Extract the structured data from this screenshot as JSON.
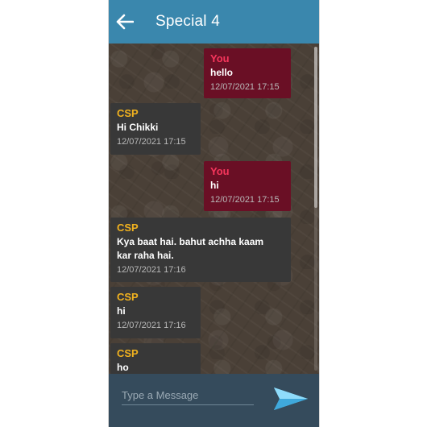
{
  "header": {
    "title": "Special 4",
    "back_icon": "arrow-left-icon"
  },
  "messages": [
    {
      "sender": "You",
      "text": "hello",
      "time": "12/07/2021 17:15"
    },
    {
      "sender": "CSP",
      "text": "Hi Chikki",
      "time": "12/07/2021 17:15"
    },
    {
      "sender": "You",
      "text": "hi",
      "time": "12/07/2021 17:15"
    },
    {
      "sender": "CSP",
      "text_lines": [
        "Kya baat hai. bahut achha kaam",
        "kar raha hai."
      ],
      "time": "12/07/2021 17:16"
    },
    {
      "sender": "CSP",
      "text": "hi",
      "time": "12/07/2021 17:16"
    },
    {
      "sender": "CSP",
      "text": "ho",
      "time": ""
    }
  ],
  "compose": {
    "placeholder": "Type a Message",
    "send_icon": "send-icon"
  },
  "colors": {
    "header": "#3a87ad",
    "you_bubble": "#6a0f25",
    "them_bubble": "#383838",
    "you_name": "#f7365c",
    "them_name": "#f1b21f",
    "compose_bar": "#354b5c",
    "send_icon": "#5bc8f5"
  }
}
